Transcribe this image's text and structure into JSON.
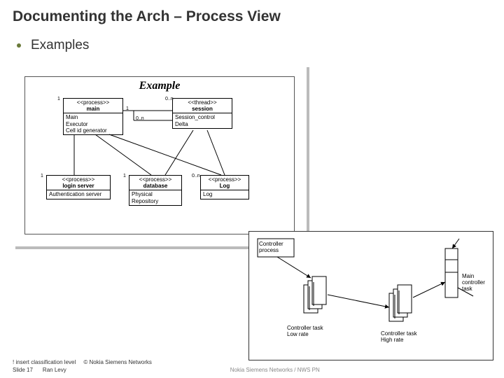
{
  "title": "Documenting the Arch –   Process View",
  "bullet": "Examples",
  "diag1": {
    "heading": "Example",
    "boxes": {
      "main": {
        "stereo": "<<process>>",
        "name": "main",
        "body": [
          "Main",
          "Executor",
          "Cell id generator"
        ]
      },
      "session": {
        "stereo": "<<thread>>",
        "name": "session",
        "body": [
          "Session_control",
          "Delta"
        ]
      },
      "login": {
        "stereo": "<<process>>",
        "name": "login server",
        "body": [
          "Authentication server"
        ]
      },
      "db": {
        "stereo": "<<process>>",
        "name": "database",
        "body": [
          "Physical",
          "Repository"
        ]
      },
      "log": {
        "stereo": "<<process>>",
        "name": "Log",
        "body": [
          "Log"
        ]
      }
    },
    "mult": {
      "m1": "1",
      "m0n": "0..n",
      "m1b": "1",
      "m0nb": "0..n",
      "l1": "1",
      "l1b": "1",
      "l0n": "0..n"
    }
  },
  "diag2": {
    "labels": {
      "cp": "Controller\nprocess",
      "low": "Controller task\nLow rate",
      "high": "Controller task\nHigh rate",
      "mct": "Main\ncontroller\ntask"
    }
  },
  "footer": {
    "class": "! insert classification level",
    "copyright": "© Nokia Siemens Networks",
    "slide": "Slide 17",
    "author": "Ran Levy",
    "brand": "Nokia Siemens Networks / NWS PN"
  }
}
